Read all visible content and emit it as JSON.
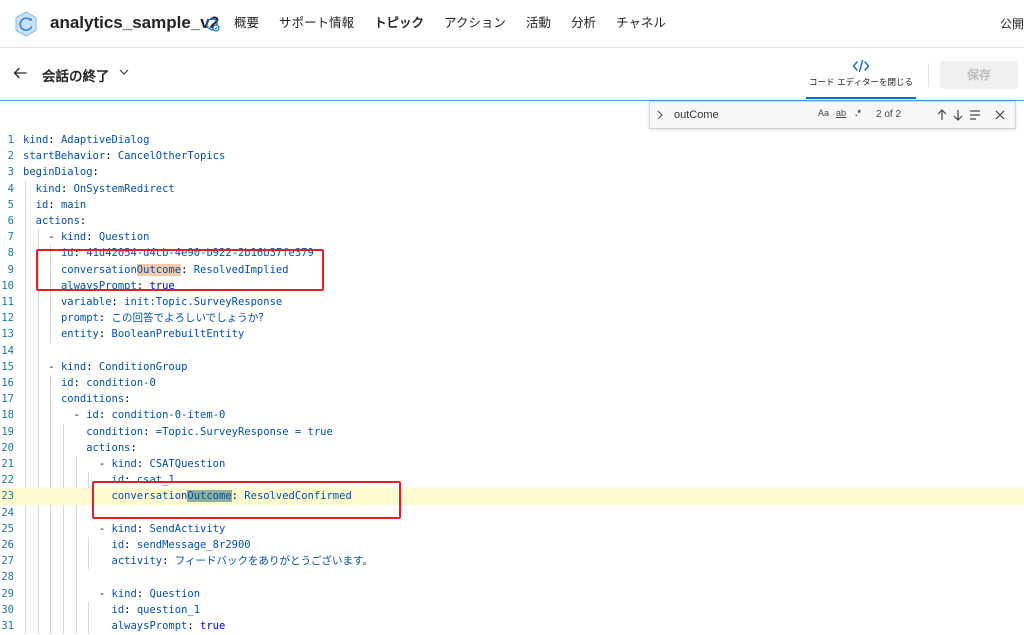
{
  "app": {
    "title": "analytics_sample_v2",
    "nav": [
      "概要",
      "サポート情報",
      "トピック",
      "アクション",
      "活動",
      "分析",
      "チャネル"
    ],
    "active_nav": 2,
    "publish_label": "公開"
  },
  "topic": {
    "title": "会話の終了",
    "code_editor_label": "コード エディターを閉じる",
    "save_label": "保存"
  },
  "find": {
    "query": "outCome",
    "match_case_label": "Aa",
    "whole_word_label": "ab",
    "regex_label": ".*",
    "count": "2 of 2"
  },
  "code_lines": [
    {
      "n": "1",
      "indent": "",
      "key": "kind",
      "value": "AdaptiveDialog"
    },
    {
      "n": "2",
      "indent": "",
      "key": "startBehavior",
      "value": "CancelOtherTopics"
    },
    {
      "n": "3",
      "indent": "",
      "key": "beginDialog",
      "value": ""
    },
    {
      "n": "4",
      "indent": "  ",
      "key": "kind",
      "value": "OnSystemRedirect"
    },
    {
      "n": "5",
      "indent": "  ",
      "key": "id",
      "value": "main"
    },
    {
      "n": "6",
      "indent": "  ",
      "key": "actions",
      "value": ""
    },
    {
      "n": "7",
      "indent": "    - ",
      "key": "kind",
      "value": "Question"
    },
    {
      "n": "8",
      "indent": "      ",
      "key": "id",
      "value": "41d42054-d4cb-4e90-b922-2b16b37fe379"
    },
    {
      "n": "9",
      "indent": "      ",
      "key": "conversationOutcome",
      "value": "ResolvedImplied",
      "match": 1
    },
    {
      "n": "10",
      "indent": "      ",
      "key": "alwaysPrompt",
      "value": "true",
      "bool": true
    },
    {
      "n": "11",
      "indent": "      ",
      "key": "variable",
      "value": "init:Topic.SurveyResponse"
    },
    {
      "n": "12",
      "indent": "      ",
      "key": "prompt",
      "value": "この回答でよろしいでしょうか?",
      "jp": true
    },
    {
      "n": "13",
      "indent": "      ",
      "key": "entity",
      "value": "BooleanPrebuiltEntity"
    },
    {
      "n": "14",
      "indent": "",
      "key": "",
      "value": ""
    },
    {
      "n": "15",
      "indent": "    - ",
      "key": "kind",
      "value": "ConditionGroup"
    },
    {
      "n": "16",
      "indent": "      ",
      "key": "id",
      "value": "condition-0"
    },
    {
      "n": "17",
      "indent": "      ",
      "key": "conditions",
      "value": ""
    },
    {
      "n": "18",
      "indent": "        - ",
      "key": "id",
      "value": "condition-0-item-0"
    },
    {
      "n": "19",
      "indent": "          ",
      "key": "condition",
      "value": "=Topic.SurveyResponse = true"
    },
    {
      "n": "20",
      "indent": "          ",
      "key": "actions",
      "value": ""
    },
    {
      "n": "21",
      "indent": "            - ",
      "key": "kind",
      "value": "CSATQuestion"
    },
    {
      "n": "22",
      "indent": "              ",
      "key": "id",
      "value": "csat_1"
    },
    {
      "n": "23",
      "indent": "              ",
      "key": "conversationOutcome",
      "value": "ResolvedConfirmed",
      "match": 2,
      "current": true
    },
    {
      "n": "24",
      "indent": "",
      "key": "",
      "value": ""
    },
    {
      "n": "25",
      "indent": "            - ",
      "key": "kind",
      "value": "SendActivity"
    },
    {
      "n": "26",
      "indent": "              ",
      "key": "id",
      "value": "sendMessage_8r2900"
    },
    {
      "n": "27",
      "indent": "              ",
      "key": "activity",
      "value": "フィードバックをありがとうございます。",
      "jp": true
    },
    {
      "n": "28",
      "indent": "",
      "key": "",
      "value": ""
    },
    {
      "n": "29",
      "indent": "            - ",
      "key": "kind",
      "value": "Question"
    },
    {
      "n": "30",
      "indent": "              ",
      "key": "id",
      "value": "question_1"
    },
    {
      "n": "31",
      "indent": "              ",
      "key": "alwaysPrompt",
      "value": "true",
      "bool": true
    }
  ],
  "colors": {
    "accent": "#0f6cbd",
    "highlight_box": "#e0202a"
  }
}
